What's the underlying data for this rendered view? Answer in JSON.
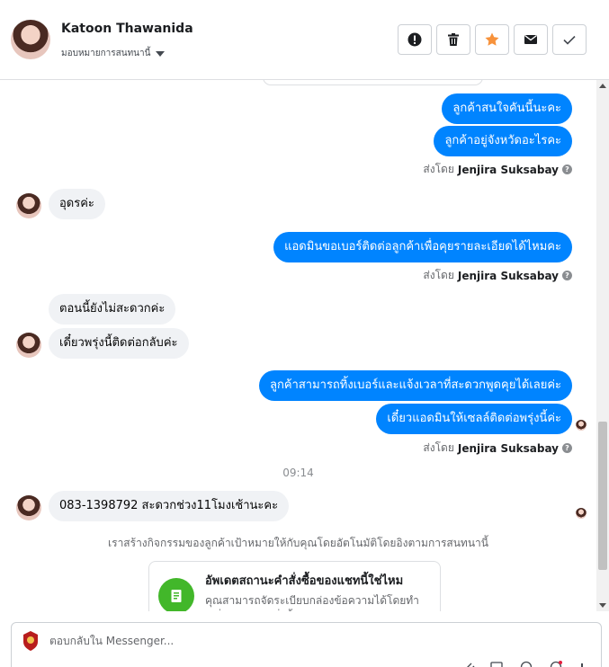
{
  "header": {
    "contact_name": "Katoon Thawanida",
    "assign_label": "มอบหมายการสนทนานี้",
    "actions": [
      "spam-icon",
      "trash-icon",
      "star-icon",
      "mail-icon",
      "check-icon"
    ]
  },
  "colors": {
    "outgoing_bubble": "#0084ff",
    "incoming_bubble": "#f0f2f5",
    "star": "#f7923b",
    "update_icon": "#42b72a"
  },
  "messages": {
    "m1": "ลูกค้าสนใจคันนี้นะคะ",
    "m2": "ลูกค้าอยู่จังหวัดอะไรคะ",
    "m3": "อุดรค่ะ",
    "m4": "แอดมินขอเบอร์ติดต่อลูกค้าเพื่อคุยรายละเอียดได้ไหมคะ",
    "m5": "ตอนนี้ยังไม่สะดวกค่ะ",
    "m6": "เดี๋ยวพรุ่งนี้ติดต่อกลับค่ะ",
    "m7": "ลูกค้าสามารถทิ้งเบอร์และแจ้งเวลาที่สะดวกพูดคุยได้เลยค่ะ",
    "m8": "เดี๋ยวแอดมินให้เซลล์ติดต่อพรุ่งนี้ค่ะ",
    "m9": "083-1398792 สะดวกช่วง11โมงเช้านะคะ"
  },
  "sender": {
    "prefix": "ส่งโดย",
    "name": "Jenjira Suksabay"
  },
  "timestamp": "09:14",
  "system_note": "เราสร้างกิจกรรมของลูกค้าเป้าหมายให้กับคุณโดยอัตโนมัติโดยอิงตามการสนทนานี้",
  "update_card": {
    "title": "อัพเดตสถานะคำสั่งซื้อของแชทนี้ใช่ไหม",
    "description": "คุณสามารถจัดระเบียบกล่องข้อความได้โดยทำเครื่องหมายคำสั่งซื้อว่าชำระเงินแล้ว"
  },
  "composer": {
    "placeholder": "ตอบกลับใน Messenger..."
  }
}
